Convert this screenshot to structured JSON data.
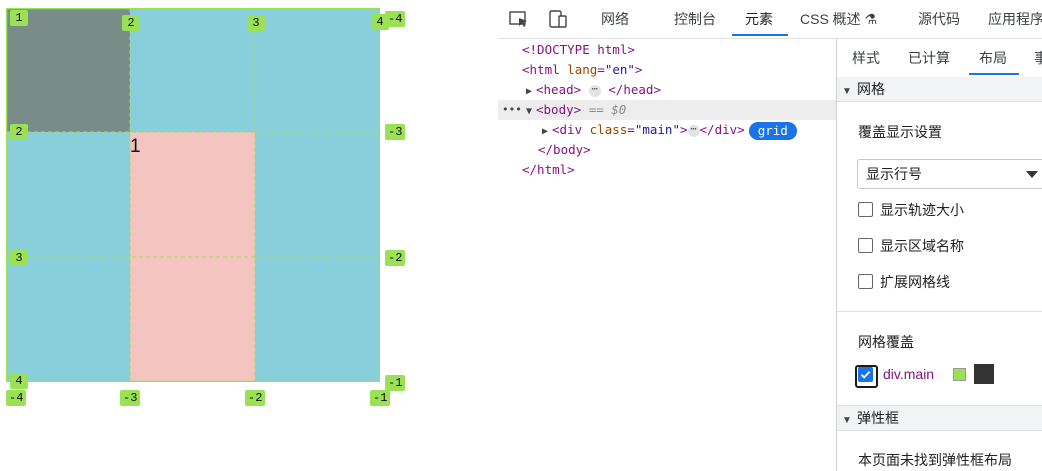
{
  "preview": {
    "line_numbers": {
      "top": [
        "1",
        "2",
        "3",
        "4",
        "-4"
      ],
      "left": [
        "2",
        "3",
        "4",
        "-4"
      ],
      "right": [
        "-3",
        "-2",
        "-1"
      ],
      "bottom": [
        "-3",
        "-2",
        "-1"
      ]
    },
    "item_label": "1",
    "colors": {
      "overlay": "#9be155",
      "cell_dark": "#798c88",
      "cell_blue": "#89cfdb",
      "cell_pink": "#f3c4c0"
    }
  },
  "devtools": {
    "toolbar": {
      "tabs": [
        "网络",
        "控制台",
        "元素",
        "CSS 概述 ⚗",
        "源代码",
        "应用程序"
      ],
      "active_tab": "元素",
      "icons": [
        "inspect-icon",
        "device-toolbar-icon"
      ]
    },
    "dom": {
      "doctype": "<!DOCTYPE html>",
      "html_tag": "html",
      "html_attr": "lang",
      "html_value": "\"en\"",
      "head_tag": "head",
      "body_tag": "body",
      "selected_hint": "== $0",
      "div_tag": "div",
      "div_attr": "class",
      "div_value": "\"main\"",
      "grid_badge": "grid",
      "body_close": "</body>",
      "html_close": "</html>",
      "ellipsis": "⋯",
      "row_dots": "•••"
    },
    "sidebar": {
      "tabs": [
        "样式",
        "已计算",
        "布局",
        "事"
      ],
      "active_tab": "布局",
      "grid_section": {
        "title": "网格",
        "overlay_settings_label": "覆盖显示设置",
        "select_value": "显示行号",
        "checkboxes": [
          {
            "label": "显示轨迹大小",
            "checked": false
          },
          {
            "label": "显示区域名称",
            "checked": false
          },
          {
            "label": "扩展网格线",
            "checked": false
          }
        ],
        "overlay_label": "网格覆盖",
        "overlay_item": {
          "label": "div.main",
          "checked": true,
          "swatch_color": "#9be155",
          "swatch_dark": "#333333"
        }
      },
      "flex_section": {
        "title": "弹性框",
        "message": "本页面未找到弹性框布局"
      }
    }
  }
}
